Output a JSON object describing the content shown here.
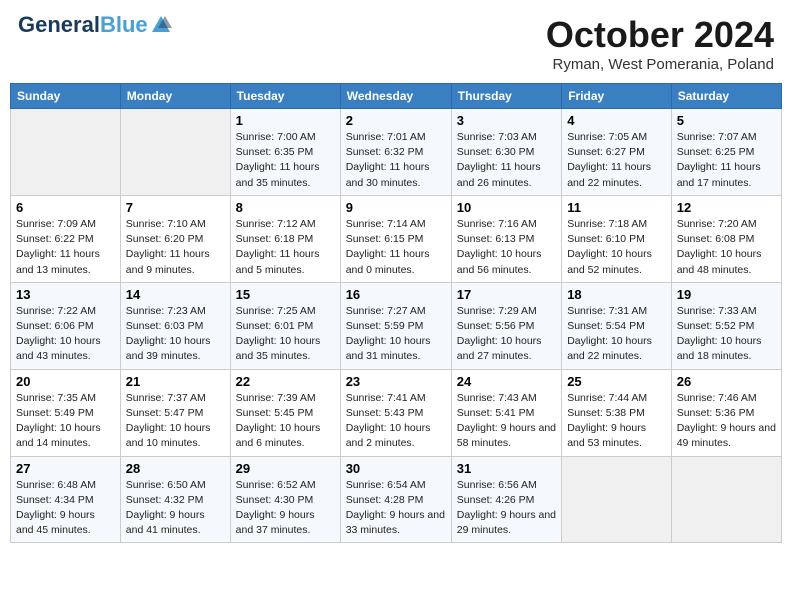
{
  "header": {
    "logo_general": "General",
    "logo_blue": "Blue",
    "month": "October 2024",
    "location": "Ryman, West Pomerania, Poland"
  },
  "weekdays": [
    "Sunday",
    "Monday",
    "Tuesday",
    "Wednesday",
    "Thursday",
    "Friday",
    "Saturday"
  ],
  "weeks": [
    [
      {
        "day": "",
        "info": ""
      },
      {
        "day": "",
        "info": ""
      },
      {
        "day": "1",
        "info": "Sunrise: 7:00 AM\nSunset: 6:35 PM\nDaylight: 11 hours and 35 minutes."
      },
      {
        "day": "2",
        "info": "Sunrise: 7:01 AM\nSunset: 6:32 PM\nDaylight: 11 hours and 30 minutes."
      },
      {
        "day": "3",
        "info": "Sunrise: 7:03 AM\nSunset: 6:30 PM\nDaylight: 11 hours and 26 minutes."
      },
      {
        "day": "4",
        "info": "Sunrise: 7:05 AM\nSunset: 6:27 PM\nDaylight: 11 hours and 22 minutes."
      },
      {
        "day": "5",
        "info": "Sunrise: 7:07 AM\nSunset: 6:25 PM\nDaylight: 11 hours and 17 minutes."
      }
    ],
    [
      {
        "day": "6",
        "info": "Sunrise: 7:09 AM\nSunset: 6:22 PM\nDaylight: 11 hours and 13 minutes."
      },
      {
        "day": "7",
        "info": "Sunrise: 7:10 AM\nSunset: 6:20 PM\nDaylight: 11 hours and 9 minutes."
      },
      {
        "day": "8",
        "info": "Sunrise: 7:12 AM\nSunset: 6:18 PM\nDaylight: 11 hours and 5 minutes."
      },
      {
        "day": "9",
        "info": "Sunrise: 7:14 AM\nSunset: 6:15 PM\nDaylight: 11 hours and 0 minutes."
      },
      {
        "day": "10",
        "info": "Sunrise: 7:16 AM\nSunset: 6:13 PM\nDaylight: 10 hours and 56 minutes."
      },
      {
        "day": "11",
        "info": "Sunrise: 7:18 AM\nSunset: 6:10 PM\nDaylight: 10 hours and 52 minutes."
      },
      {
        "day": "12",
        "info": "Sunrise: 7:20 AM\nSunset: 6:08 PM\nDaylight: 10 hours and 48 minutes."
      }
    ],
    [
      {
        "day": "13",
        "info": "Sunrise: 7:22 AM\nSunset: 6:06 PM\nDaylight: 10 hours and 43 minutes."
      },
      {
        "day": "14",
        "info": "Sunrise: 7:23 AM\nSunset: 6:03 PM\nDaylight: 10 hours and 39 minutes."
      },
      {
        "day": "15",
        "info": "Sunrise: 7:25 AM\nSunset: 6:01 PM\nDaylight: 10 hours and 35 minutes."
      },
      {
        "day": "16",
        "info": "Sunrise: 7:27 AM\nSunset: 5:59 PM\nDaylight: 10 hours and 31 minutes."
      },
      {
        "day": "17",
        "info": "Sunrise: 7:29 AM\nSunset: 5:56 PM\nDaylight: 10 hours and 27 minutes."
      },
      {
        "day": "18",
        "info": "Sunrise: 7:31 AM\nSunset: 5:54 PM\nDaylight: 10 hours and 22 minutes."
      },
      {
        "day": "19",
        "info": "Sunrise: 7:33 AM\nSunset: 5:52 PM\nDaylight: 10 hours and 18 minutes."
      }
    ],
    [
      {
        "day": "20",
        "info": "Sunrise: 7:35 AM\nSunset: 5:49 PM\nDaylight: 10 hours and 14 minutes."
      },
      {
        "day": "21",
        "info": "Sunrise: 7:37 AM\nSunset: 5:47 PM\nDaylight: 10 hours and 10 minutes."
      },
      {
        "day": "22",
        "info": "Sunrise: 7:39 AM\nSunset: 5:45 PM\nDaylight: 10 hours and 6 minutes."
      },
      {
        "day": "23",
        "info": "Sunrise: 7:41 AM\nSunset: 5:43 PM\nDaylight: 10 hours and 2 minutes."
      },
      {
        "day": "24",
        "info": "Sunrise: 7:43 AM\nSunset: 5:41 PM\nDaylight: 9 hours and 58 minutes."
      },
      {
        "day": "25",
        "info": "Sunrise: 7:44 AM\nSunset: 5:38 PM\nDaylight: 9 hours and 53 minutes."
      },
      {
        "day": "26",
        "info": "Sunrise: 7:46 AM\nSunset: 5:36 PM\nDaylight: 9 hours and 49 minutes."
      }
    ],
    [
      {
        "day": "27",
        "info": "Sunrise: 6:48 AM\nSunset: 4:34 PM\nDaylight: 9 hours and 45 minutes."
      },
      {
        "day": "28",
        "info": "Sunrise: 6:50 AM\nSunset: 4:32 PM\nDaylight: 9 hours and 41 minutes."
      },
      {
        "day": "29",
        "info": "Sunrise: 6:52 AM\nSunset: 4:30 PM\nDaylight: 9 hours and 37 minutes."
      },
      {
        "day": "30",
        "info": "Sunrise: 6:54 AM\nSunset: 4:28 PM\nDaylight: 9 hours and 33 minutes."
      },
      {
        "day": "31",
        "info": "Sunrise: 6:56 AM\nSunset: 4:26 PM\nDaylight: 9 hours and 29 minutes."
      },
      {
        "day": "",
        "info": ""
      },
      {
        "day": "",
        "info": ""
      }
    ]
  ]
}
